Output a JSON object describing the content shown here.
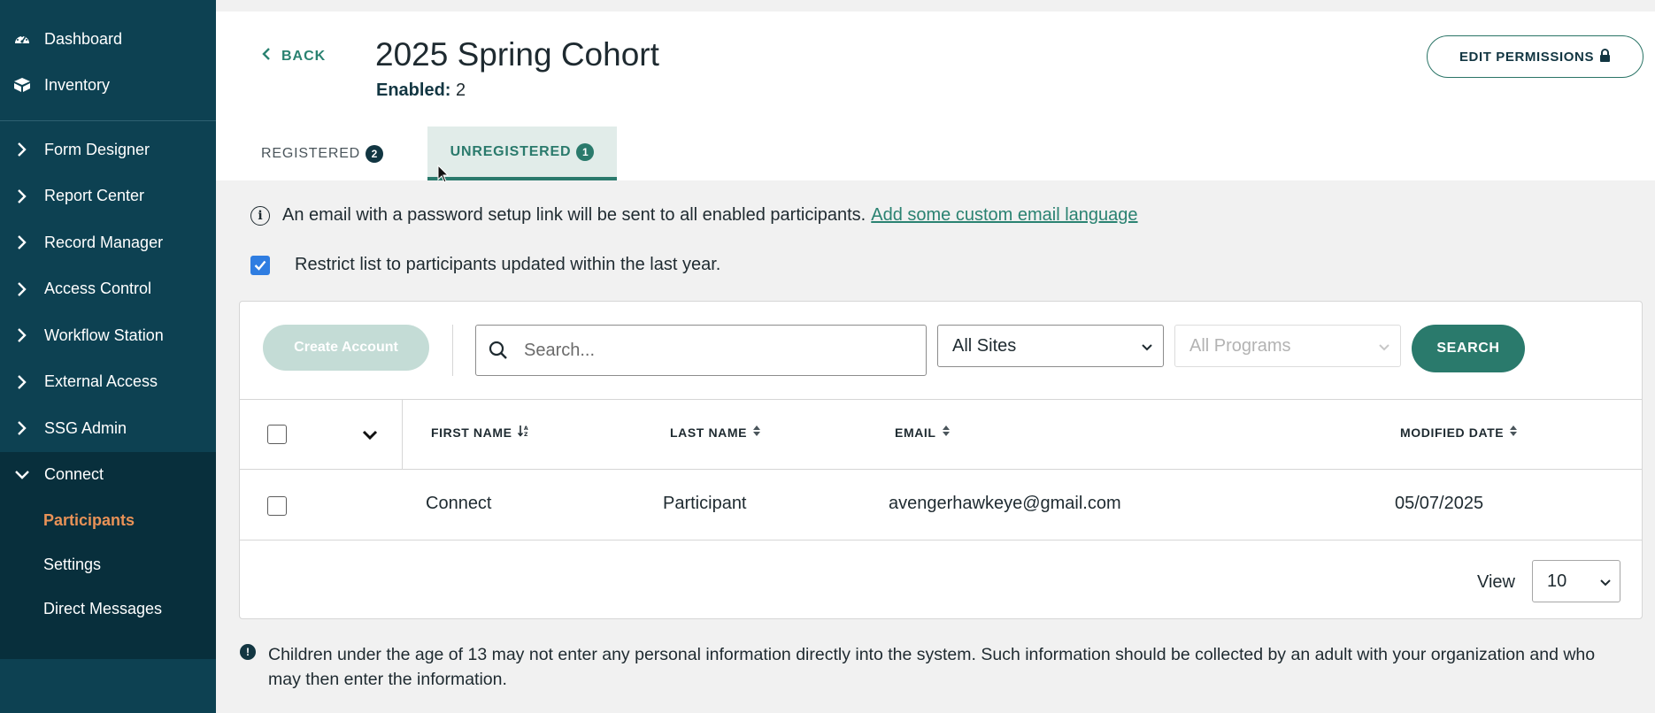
{
  "sidebar": {
    "top_items": [
      {
        "label": "Dashboard",
        "icon": "dashboard-icon"
      },
      {
        "label": "Inventory",
        "icon": "boxes-icon"
      }
    ],
    "nav_items": [
      {
        "label": "Form Designer"
      },
      {
        "label": "Report Center"
      },
      {
        "label": "Record Manager"
      },
      {
        "label": "Access Control"
      },
      {
        "label": "Workflow Station"
      },
      {
        "label": "External Access"
      },
      {
        "label": "SSG Admin"
      }
    ],
    "connect": {
      "label": "Connect",
      "sub_items": [
        {
          "label": "Participants",
          "active": true
        },
        {
          "label": "Settings"
        },
        {
          "label": "Direct Messages"
        }
      ]
    }
  },
  "header": {
    "back_label": "BACK",
    "title": "2025 Spring Cohort",
    "enabled_label": "Enabled:",
    "enabled_count": "2",
    "edit_permissions_label": "EDIT PERMISSIONS"
  },
  "tabs": [
    {
      "label": "REGISTERED",
      "count": "2",
      "active": false
    },
    {
      "label": "UNREGISTERED",
      "count": "1",
      "active": true
    }
  ],
  "info": {
    "text": "An email with a password setup link will be sent to all enabled participants.",
    "link": "Add some custom email language"
  },
  "restrict": {
    "label": "Restrict list to participants updated within the last year.",
    "checked": true
  },
  "toolbar": {
    "create_account_label": "Create Account",
    "search_placeholder": "Search...",
    "sites_selected": "All Sites",
    "programs_selected": "All Programs",
    "search_button_label": "SEARCH"
  },
  "table": {
    "columns": [
      "FIRST NAME",
      "LAST NAME",
      "EMAIL",
      "MODIFIED DATE"
    ],
    "rows": [
      {
        "first_name": "Connect",
        "last_name": "Participant",
        "email": "avengerhawkeye@gmail.com",
        "modified_date": "05/07/2025"
      }
    ]
  },
  "pagination": {
    "view_label": "View",
    "page_size": "10"
  },
  "notice": "Children under the age of 13 may not enter any personal information directly into the system. Such information should be collected by an adult with your organization and who may then enter the information.",
  "colors": {
    "sidebar_bg": "#0d4152",
    "accent": "#2a7a6c",
    "active_sub": "#e99257"
  }
}
